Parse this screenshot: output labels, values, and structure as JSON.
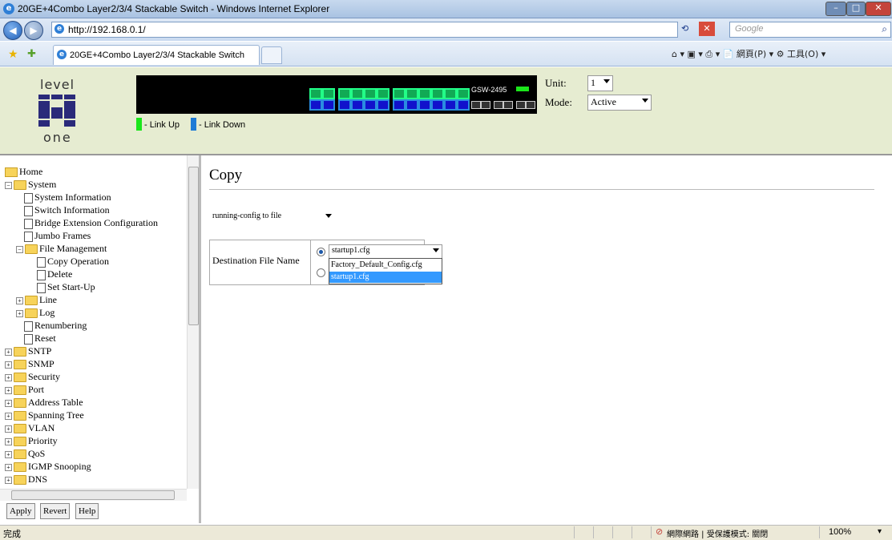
{
  "window": {
    "title": "20GE+4Combo Layer2/3/4 Stackable Switch - Windows Internet Explorer"
  },
  "browser": {
    "url": "http://192.168.0.1/",
    "search_placeholder": "Google",
    "tab_title": "20GE+4Combo Layer2/3/4 Stackable Switch",
    "command_bar": "⌂ ▾ ▣ ▾ ⎙ ▾ 📄 網頁(P) ▾ ⚙ 工具(O) ▾"
  },
  "header": {
    "logo_top": "level",
    "logo_bottom": "one",
    "model": "GSW-2495",
    "legend_up": "- Link Up",
    "legend_down": "- Link Down",
    "unit_label": "Unit:",
    "unit_value": "1",
    "mode_label": "Mode:",
    "mode_value": "Active",
    "status_colors": {
      "link_up": "#1be61b",
      "link_down": "#1e7bd6"
    }
  },
  "nav": {
    "items": [
      {
        "label": "Home"
      },
      {
        "label": "System"
      },
      {
        "label": "System Information"
      },
      {
        "label": "Switch Information"
      },
      {
        "label": "Bridge Extension Configuration"
      },
      {
        "label": "Jumbo Frames"
      },
      {
        "label": "File Management"
      },
      {
        "label": "Copy Operation"
      },
      {
        "label": "Delete"
      },
      {
        "label": "Set Start-Up"
      },
      {
        "label": "Line"
      },
      {
        "label": "Log"
      },
      {
        "label": "Renumbering"
      },
      {
        "label": "Reset"
      },
      {
        "label": "SNTP"
      },
      {
        "label": "SNMP"
      },
      {
        "label": "Security"
      },
      {
        "label": "Port"
      },
      {
        "label": "Address Table"
      },
      {
        "label": "Spanning Tree"
      },
      {
        "label": "VLAN"
      },
      {
        "label": "Priority"
      },
      {
        "label": "QoS"
      },
      {
        "label": "IGMP Snooping"
      },
      {
        "label": "DNS"
      }
    ],
    "buttons": {
      "apply": "Apply",
      "revert": "Revert",
      "help": "Help"
    }
  },
  "main": {
    "title": "Copy",
    "operation": "running-config to file",
    "dest_label": "Destination File Name",
    "file_value": "startup1.cfg",
    "file_options": [
      "Factory_Default_Config.cfg",
      "startup1.cfg"
    ],
    "selected_option": "startup1.cfg"
  },
  "statusbar": {
    "left": "完成",
    "zone": "網際網路 | 受保護模式: 關閉",
    "zoom": "100%"
  }
}
